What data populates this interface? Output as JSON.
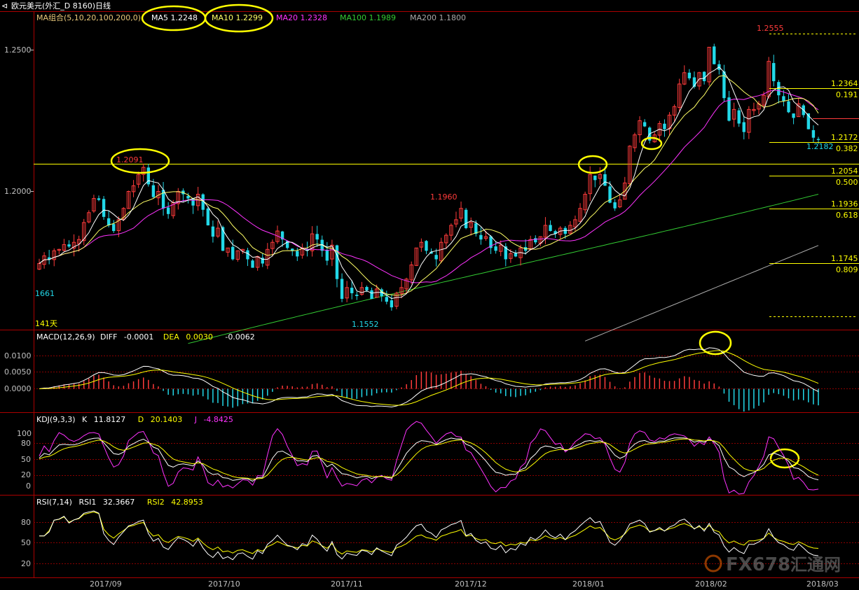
{
  "window": {
    "title": "欧元美元(外汇_D 8160)日线",
    "title_color": "#ffffff"
  },
  "colors": {
    "background": "#000000",
    "up_candle": "#ff3b3b",
    "down_candle": "#22d8e8",
    "yellow": "#ffff00",
    "ma5": "#ffffff",
    "ma10": "#ffff66",
    "ma20": "#ff33ff",
    "ma100": "#33cc33",
    "ma200": "#aaaaaa",
    "grid": "#8b0000",
    "axis_text": "#c0c0c0",
    "annotation_circle": "#ffff00"
  },
  "price_panel": {
    "legend": {
      "label": "MA组合(5,10,20,100,200,0)",
      "items": [
        {
          "name": "MA5",
          "value": "1.2248",
          "color": "#ffffff"
        },
        {
          "name": "MA10",
          "value": "1.2299",
          "color": "#ffff66"
        },
        {
          "name": "MA20",
          "value": "1.2328",
          "color": "#ff33ff"
        },
        {
          "name": "MA100",
          "value": "1.1989",
          "color": "#33cc33"
        },
        {
          "name": "MA200",
          "value": "1.1800",
          "color": "#aaaaaa"
        }
      ]
    },
    "y_ticks": [
      "1.2500",
      "1.2000"
    ],
    "marks": {
      "high_2091": "1.2091",
      "high_1960": "1.1960",
      "high_2555": "1.2555",
      "low_1552": "1.1552",
      "last_2182": "1.2182",
      "left_1661": "1661",
      "days": "141天"
    },
    "fib_levels": [
      {
        "price": "1.2364",
        "ratio": "0.191"
      },
      {
        "price": "1.2172",
        "ratio": "0.382"
      },
      {
        "price": "1.2054",
        "ratio": "0.500"
      },
      {
        "price": "1.1936",
        "ratio": "0.618"
      },
      {
        "price": "1.1745",
        "ratio": "0.809"
      }
    ]
  },
  "macd_panel": {
    "label": "MACD(12,26,9)",
    "diff_label": "DIFF",
    "diff_value": "-0.0001",
    "dea_label": "DEA",
    "dea_value": "0.0030",
    "macd_value": "-0.0062",
    "y_ticks": [
      "0.0100",
      "0.0050",
      "0.0000"
    ]
  },
  "kdj_panel": {
    "label": "KDJ(9,3,3)",
    "k_label": "K",
    "k_value": "11.8127",
    "d_label": "D",
    "d_value": "20.1403",
    "j_label": "J",
    "j_value": "-4.8425",
    "y_ticks": [
      "100",
      "80",
      "50",
      "20",
      "0"
    ]
  },
  "rsi_panel": {
    "label": "RSI(7,14)",
    "rsi1_label": "RSI1",
    "rsi1_value": "32.3667",
    "rsi2_label": "RSI2",
    "rsi2_value": "42.8953",
    "y_ticks": [
      "80",
      "50",
      "20"
    ]
  },
  "x_axis": {
    "labels": [
      "2017/09",
      "2017/10",
      "2017/11",
      "2017/12",
      "2018/01",
      "2018/02",
      "2018/03"
    ]
  },
  "watermark": {
    "text": "FX678",
    "text_cn": "汇通网"
  },
  "chart_data": {
    "type": "candlestick",
    "y_range": [
      1.149,
      1.2605
    ],
    "levels": {
      "horizontal_line": 1.2091,
      "dotted_top": 1.2555,
      "fib": [
        1.2364,
        1.2172,
        1.2054,
        1.1936,
        1.1745
      ]
    },
    "macd_range": [
      -0.007,
      0.0145
    ],
    "kdj_range": [
      -12,
      122
    ],
    "rsi_range": [
      5,
      100
    ],
    "series_keys": [
      "candles",
      "ma",
      "macd_diff",
      "macd_dea",
      "macd_hist",
      "kdj_k",
      "kdj_d",
      "kdj_j",
      "rsi1",
      "rsi2"
    ],
    "closes": [
      1.1745,
      1.1772,
      1.176,
      1.179,
      1.1795,
      1.1812,
      1.1805,
      1.182,
      1.183,
      1.189,
      1.1925,
      1.1975,
      1.197,
      1.191,
      1.188,
      1.186,
      1.19,
      1.194,
      1.2,
      1.202,
      1.206,
      1.2085,
      1.2025,
      1.198,
      1.2,
      1.194,
      1.192,
      1.196,
      1.2,
      1.199,
      1.1975,
      1.195,
      1.199,
      1.1935,
      1.188,
      1.184,
      1.187,
      1.179,
      1.18,
      1.176,
      1.179,
      1.1795,
      1.176,
      1.173,
      1.177,
      1.1745,
      1.1795,
      1.182,
      1.186,
      1.183,
      1.18,
      1.179,
      1.177,
      1.18,
      1.179,
      1.185,
      1.183,
      1.179,
      1.1755,
      1.181,
      1.169,
      1.162,
      1.166,
      1.164,
      1.163,
      1.166,
      1.165,
      1.162,
      1.1655,
      1.163,
      1.161,
      1.159,
      1.164,
      1.166,
      1.169,
      1.174,
      1.18,
      1.182,
      1.179,
      1.178,
      1.176,
      1.182,
      1.1845,
      1.188,
      1.19,
      1.194,
      1.187,
      1.189,
      1.185,
      1.183,
      1.184,
      1.18,
      1.179,
      1.181,
      1.176,
      1.178,
      1.177,
      1.18,
      1.179,
      1.183,
      1.182,
      1.184,
      1.188,
      1.186,
      1.185,
      1.187,
      1.185,
      1.188,
      1.19,
      1.194,
      1.199,
      1.206,
      1.204,
      1.206,
      1.202,
      1.196,
      1.194,
      1.197,
      1.203,
      1.216,
      1.22,
      1.225,
      1.223,
      1.218,
      1.22,
      1.224,
      1.222,
      1.227,
      1.23,
      1.238,
      1.242,
      1.24,
      1.237,
      1.242,
      1.239,
      1.251,
      1.245,
      1.243,
      1.233,
      1.225,
      1.229,
      1.224,
      1.221,
      1.229,
      1.229,
      1.231,
      1.234,
      1.246,
      1.239,
      1.234,
      1.232,
      1.228,
      1.226,
      1.231,
      1.227,
      1.222,
      1.219,
      1.2182
    ]
  }
}
